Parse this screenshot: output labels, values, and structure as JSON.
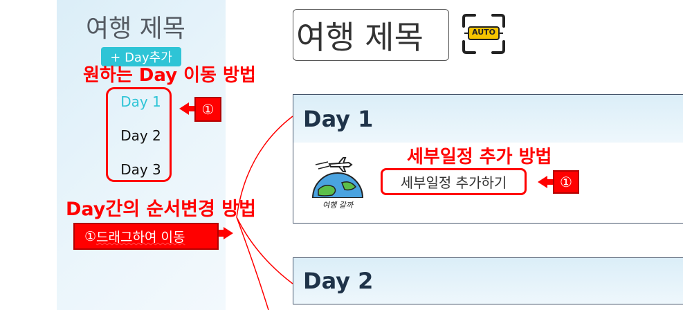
{
  "sidebar": {
    "title": "여행 제목",
    "add_day_label": "+ Day추가",
    "move_day_label": "원하는 Day 이동 방법",
    "days": [
      "Day 1",
      "Day 2",
      "Day 3"
    ],
    "active_index": 0
  },
  "callouts": {
    "circle_one": "①",
    "reorder_title": "Day간의 순서변경 방법",
    "drag_prefix": "①",
    "drag_text": "드래그하여 이동"
  },
  "main": {
    "title_value": "여행 제목",
    "auto_badge": "AUTO",
    "day_sections": [
      {
        "label": "Day 1"
      },
      {
        "label": "Day 2"
      }
    ],
    "detail_title": "세부일정 추가 방법",
    "add_detail_button": "세부일정 추가하기",
    "logo_text": "여행 갈까"
  },
  "colors": {
    "accent": "#2ec4d6",
    "annotation_red": "#ff0000",
    "header_text": "#1f3349"
  }
}
